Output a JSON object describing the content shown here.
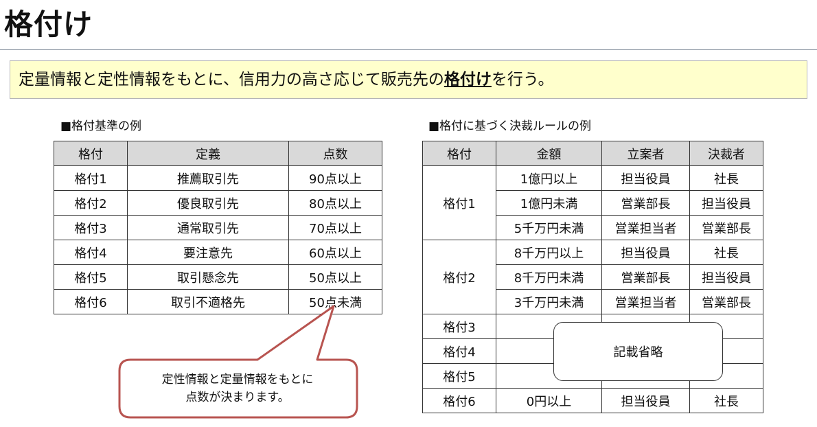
{
  "title": "格付け",
  "lead": {
    "before": "定量情報と定性情報をもとに、信用力の高さ応じて販売先の",
    "emphasis": "格付け",
    "after": "を行う。"
  },
  "left_section": {
    "title": "■格付基準の例",
    "headers": [
      "格付",
      "定義",
      "点数"
    ],
    "rows": [
      [
        "格付1",
        "推薦取引先",
        "90点以上"
      ],
      [
        "格付2",
        "優良取引先",
        "80点以上"
      ],
      [
        "格付3",
        "通常取引先",
        "70点以上"
      ],
      [
        "格付4",
        "要注意先",
        "60点以上"
      ],
      [
        "格付5",
        "取引懸念先",
        "50点以上"
      ],
      [
        "格付6",
        "取引不適格先",
        "50点未満"
      ]
    ]
  },
  "right_section": {
    "title": "■格付に基づく決裁ルールの例",
    "headers": [
      "格付",
      "金額",
      "立案者",
      "決裁者"
    ],
    "grade1": {
      "label": "格付1",
      "rows": [
        [
          "1億円以上",
          "担当役員",
          "社長"
        ],
        [
          "1億円未満",
          "営業部長",
          "担当役員"
        ],
        [
          "5千万円未満",
          "営業担当者",
          "営業部長"
        ]
      ]
    },
    "grade2": {
      "label": "格付2",
      "rows": [
        [
          "8千万円以上",
          "担当役員",
          "社長"
        ],
        [
          "8千万円未満",
          "営業部長",
          "担当役員"
        ],
        [
          "3千万円未満",
          "営業担当者",
          "営業部長"
        ]
      ]
    },
    "grade3": "格付3",
    "grade4": "格付4",
    "grade5": "格付5",
    "grade6": [
      "格付6",
      "0円以上",
      "担当役員",
      "社長"
    ],
    "omitted_note": "記載省略"
  },
  "callout": {
    "line1": "定性情報と定量情報をもとに",
    "line2": "点数が決まります。"
  },
  "colors": {
    "lead_background": "#ffffcc",
    "header_background": "#d9d9d9",
    "callout_border": "#b85450"
  }
}
